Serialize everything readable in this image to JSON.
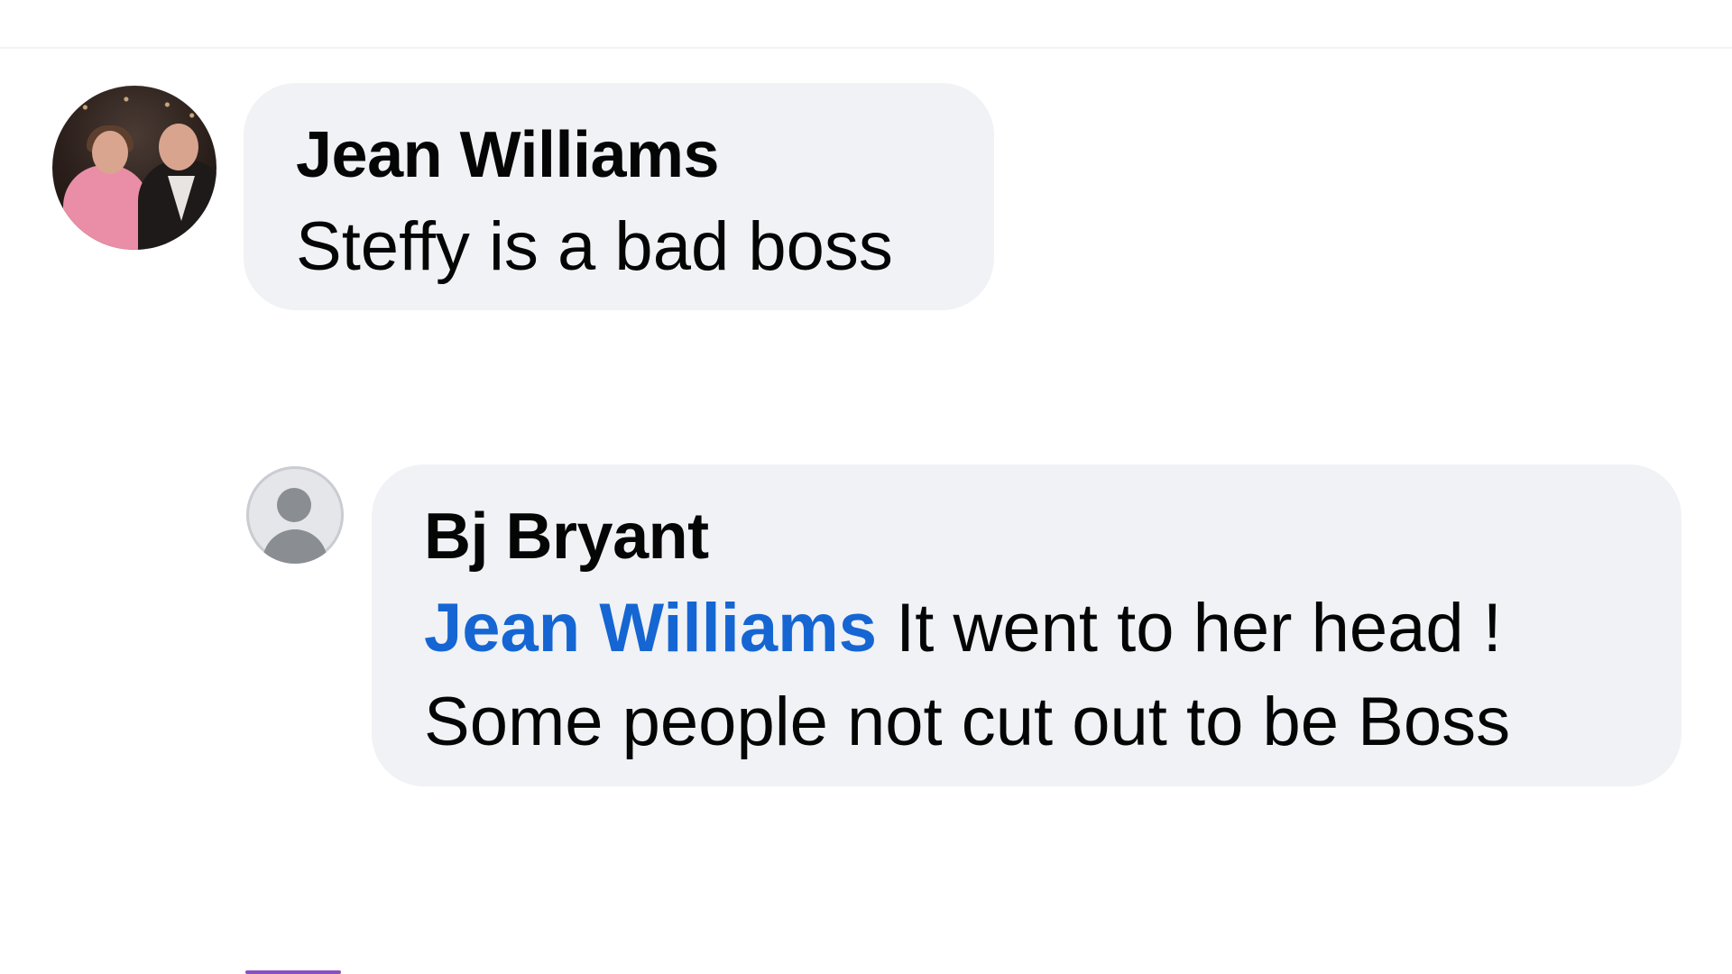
{
  "comments": [
    {
      "author": "Jean Williams",
      "text": "Steffy is a bad boss",
      "avatar": "profile-photo"
    },
    {
      "author": "Bj Bryant",
      "mention": "Jean Williams",
      "text_line_1": "It went to her head !",
      "text_line_2": "Some people not cut out to be Boss",
      "avatar": "default-user-icon"
    }
  ],
  "colors": {
    "bubble_bg": "#f0f2f5",
    "mention": "#1566d3",
    "text": "#050505"
  }
}
